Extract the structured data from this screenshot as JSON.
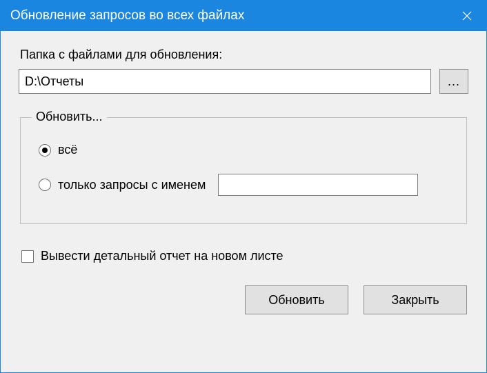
{
  "window": {
    "title": "Обновление запросов во всех файлах"
  },
  "folder": {
    "label": "Папка с файлами для обновления:",
    "path_value": "D:\\Отчеты",
    "browse_label": "..."
  },
  "update_group": {
    "legend": "Обновить...",
    "opt_all": {
      "label": "всё",
      "selected": true
    },
    "opt_named": {
      "label": "только запросы с именем",
      "selected": false,
      "name_value": ""
    }
  },
  "report_checkbox": {
    "label": "Вывести детальный отчет на новом листе",
    "checked": false
  },
  "buttons": {
    "update": "Обновить",
    "close": "Закрыть"
  }
}
